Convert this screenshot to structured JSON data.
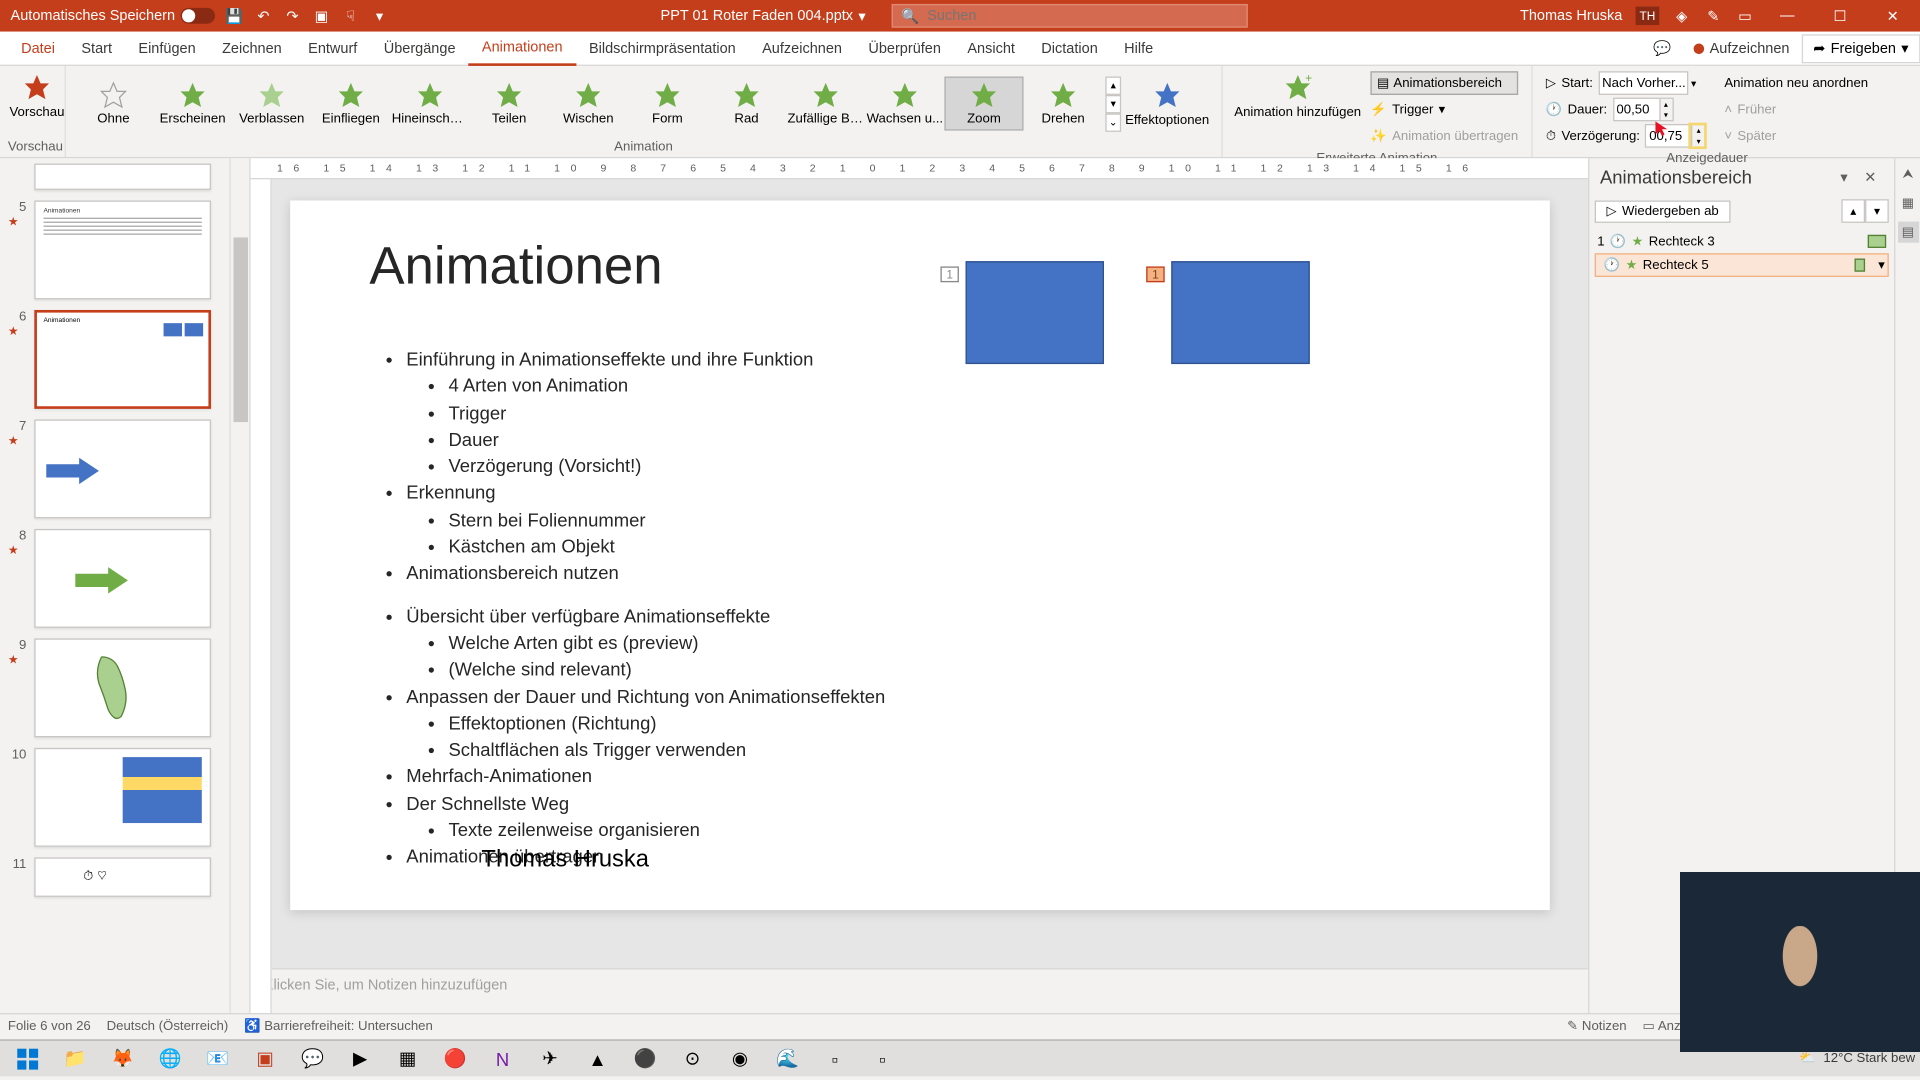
{
  "titlebar": {
    "autosave_label": "Automatisches Speichern",
    "filename": "PPT 01 Roter Faden 004.pptx",
    "search_placeholder": "Suchen",
    "username": "Thomas Hruska",
    "usertag": "TH"
  },
  "tabs": {
    "file": "Datei",
    "items": [
      "Start",
      "Einfügen",
      "Zeichnen",
      "Entwurf",
      "Übergänge",
      "Animationen",
      "Bildschirmpräsentation",
      "Aufzeichnen",
      "Überprüfen",
      "Ansicht",
      "Dictation",
      "Hilfe"
    ],
    "active_index": 5,
    "record": "Aufzeichnen",
    "share": "Freigeben"
  },
  "ribbon": {
    "preview": {
      "label": "Vorschau",
      "group": "Vorschau"
    },
    "animation": {
      "group": "Animation",
      "items": [
        "Ohne",
        "Erscheinen",
        "Verblassen",
        "Einfliegen",
        "Hineinschw...",
        "Teilen",
        "Wischen",
        "Form",
        "Rad",
        "Zufällige Ba...",
        "Wachsen u...",
        "Zoom",
        "Drehen"
      ],
      "selected_index": 11,
      "effect_options": "Effektoptionen"
    },
    "advanced": {
      "group": "Erweiterte Animation",
      "add": "Animation hinzufügen",
      "pane": "Animationsbereich",
      "trigger": "Trigger",
      "painter": "Animation übertragen"
    },
    "timing": {
      "group": "Anzeigedauer",
      "start_label": "Start:",
      "start_value": "Nach Vorher...",
      "duration_label": "Dauer:",
      "duration_value": "00,50",
      "delay_label": "Verzögerung:",
      "delay_value": "00,75",
      "reorder": "Animation neu anordnen",
      "earlier": "Früher",
      "later": "Später"
    }
  },
  "thumbs": {
    "visible": [
      {
        "num": "5",
        "star": true
      },
      {
        "num": "6",
        "star": true,
        "selected": true
      },
      {
        "num": "7",
        "star": true
      },
      {
        "num": "8",
        "star": true
      },
      {
        "num": "9",
        "star": true
      },
      {
        "num": "10",
        "star": false
      },
      {
        "num": "11",
        "star": false
      }
    ]
  },
  "slide": {
    "title": "Animationen",
    "bullets_l1_0": "Einführung in Animationseffekte und ihre Funktion",
    "bullets_l2_0_0": "4 Arten von Animation",
    "bullets_l2_0_1": "Trigger",
    "bullets_l2_0_2": "Dauer",
    "bullets_l2_0_3": "Verzögerung (Vorsicht!)",
    "bullets_l1_1": "Erkennung",
    "bullets_l2_1_0": "Stern bei Foliennummer",
    "bullets_l2_1_1": "Kästchen am Objekt",
    "bullets_l1_2": "Animationsbereich nutzen",
    "bullets_l1_3": "Übersicht über verfügbare Animationseffekte",
    "bullets_l2_3_0": "Welche Arten gibt es (preview)",
    "bullets_l2_3_1": "(Welche sind relevant)",
    "bullets_l1_4": "Anpassen der Dauer und Richtung von Animationseffekten",
    "bullets_l2_4_0": "Effektoptionen (Richtung)",
    "bullets_l2_4_1": "Schaltflächen als Trigger verwenden",
    "bullets_l1_5": "Mehrfach-Animationen",
    "bullets_l1_6": "Der Schnellste Weg",
    "bullets_l2_6_0": "Texte zeilenweise organisieren",
    "bullets_l1_7": "Animationen übertragen",
    "author": "Thomas Hruska",
    "tag1": "1",
    "tag2": "1"
  },
  "anim_pane": {
    "title": "Animationsbereich",
    "play": "Wiedergeben ab",
    "items": [
      {
        "idx": "1",
        "name": "Rechteck 3",
        "color": "#70ad47"
      },
      {
        "idx": "",
        "name": "Rechteck 5",
        "color": "#70ad47",
        "selected": true
      }
    ]
  },
  "notes": {
    "placeholder": "Klicken Sie, um Notizen hinzuzufügen"
  },
  "status": {
    "slide": "Folie 6 von 26",
    "lang": "Deutsch (Österreich)",
    "access": "Barrierefreiheit: Untersuchen",
    "notes": "Notizen",
    "display": "Anzeigeeinstellungen"
  },
  "taskbar": {
    "weather": "12°C  Stark bew"
  }
}
